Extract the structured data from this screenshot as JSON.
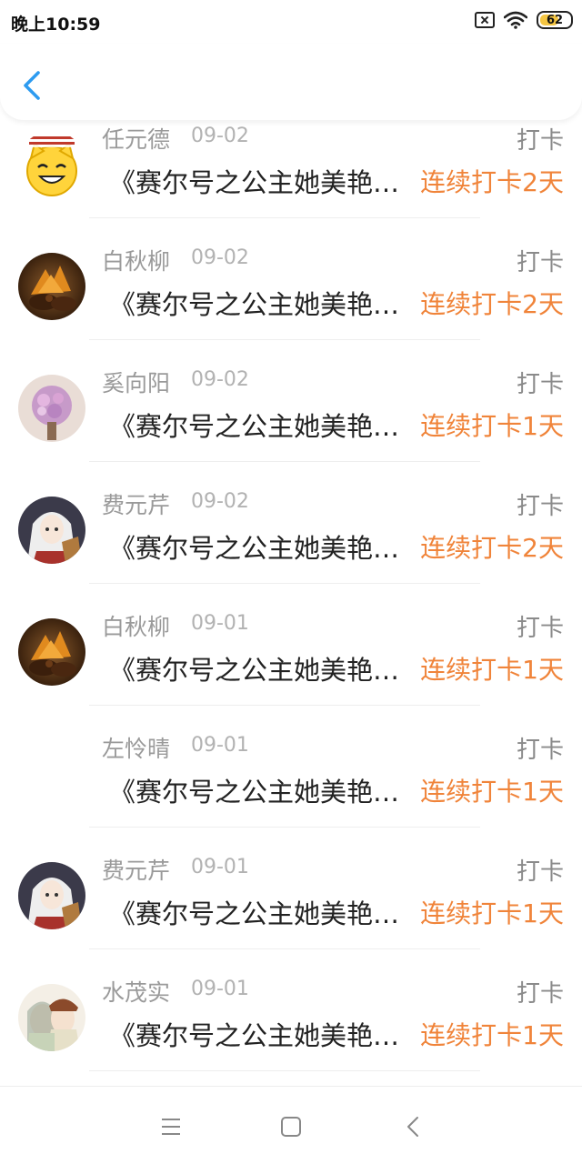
{
  "status_bar": {
    "time": "晚上10:59",
    "battery_level": "62",
    "battery_fraction": 0.62,
    "battery_color": "#f4c542",
    "icons": [
      "sim-off-icon",
      "wifi-icon",
      "battery-icon"
    ]
  },
  "header": {
    "back_icon": "chevron-left-icon",
    "accent": "#2d9bf0"
  },
  "colors": {
    "streak": "#f0843a",
    "name": "#9a9a9a"
  },
  "records": [
    {
      "name": "任元德",
      "date": "09-02",
      "action": "打卡",
      "title": "《赛尔号之公主她美艳无双》",
      "streak": "连续打卡2天",
      "avatar": "cat-smiley-avatar"
    },
    {
      "name": "白秋柳",
      "date": "09-02",
      "action": "打卡",
      "title": "《赛尔号之公主她美艳无双》",
      "streak": "连续打卡2天",
      "avatar": "autumn-leaf-avatar"
    },
    {
      "name": "奚向阳",
      "date": "09-02",
      "action": "打卡",
      "title": "《赛尔号之公主她美艳无双》",
      "streak": "连续打卡1天",
      "avatar": "flower-bouquet-avatar"
    },
    {
      "name": "费元芹",
      "date": "09-02",
      "action": "打卡",
      "title": "《赛尔号之公主她美艳无双》",
      "streak": "连续打卡2天",
      "avatar": "anime-girl-avatar"
    },
    {
      "name": "白秋柳",
      "date": "09-01",
      "action": "打卡",
      "title": "《赛尔号之公主她美艳无双》",
      "streak": "连续打卡1天",
      "avatar": "autumn-leaf-avatar"
    },
    {
      "name": "左怜晴",
      "date": "09-01",
      "action": "打卡",
      "title": "《赛尔号之公主她美艳无双》",
      "streak": "连续打卡1天",
      "avatar": "none"
    },
    {
      "name": "费元芹",
      "date": "09-01",
      "action": "打卡",
      "title": "《赛尔号之公主她美艳无双》",
      "streak": "连续打卡1天",
      "avatar": "anime-girl-avatar"
    },
    {
      "name": "水茂实",
      "date": "09-01",
      "action": "打卡",
      "title": "《赛尔号之公主她美艳无双》",
      "streak": "连续打卡1天",
      "avatar": "anime-couple-avatar"
    }
  ],
  "navbar": {
    "icons": [
      "menu-icon",
      "home-square-icon",
      "back-triangle-icon"
    ]
  }
}
